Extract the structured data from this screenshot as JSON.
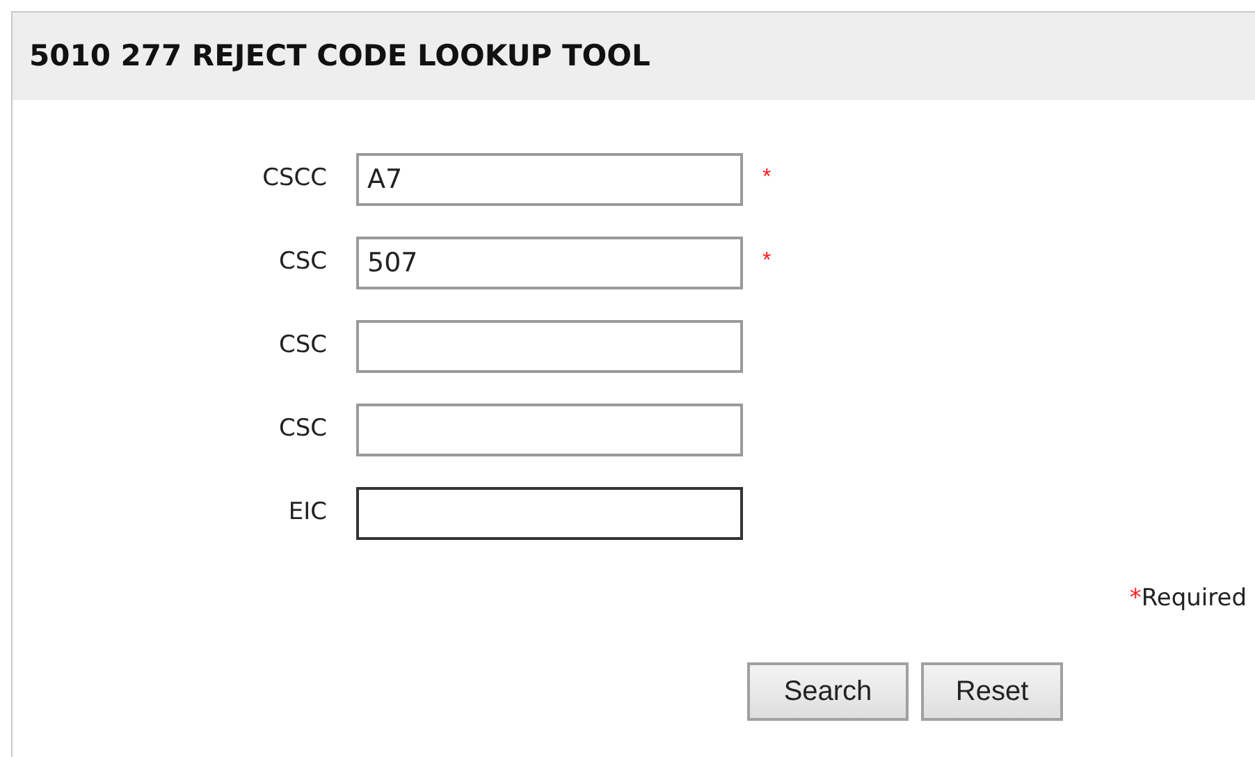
{
  "title": "5010 277 REJECT CODE LOOKUP TOOL",
  "fields": [
    {
      "label": "CSCC",
      "value": "A7",
      "required": true,
      "focused": false
    },
    {
      "label": "CSC",
      "value": "507",
      "required": true,
      "focused": false
    },
    {
      "label": "CSC",
      "required": false,
      "focused": false
    },
    {
      "label": "CSC",
      "required": false,
      "focused": false
    },
    {
      "label": "EIC",
      "required": false,
      "focused": true
    }
  ],
  "required_mark": "*",
  "required_note": {
    "mark": "*",
    "text": "Required"
  },
  "buttons": [
    "Search",
    "Reset"
  ]
}
